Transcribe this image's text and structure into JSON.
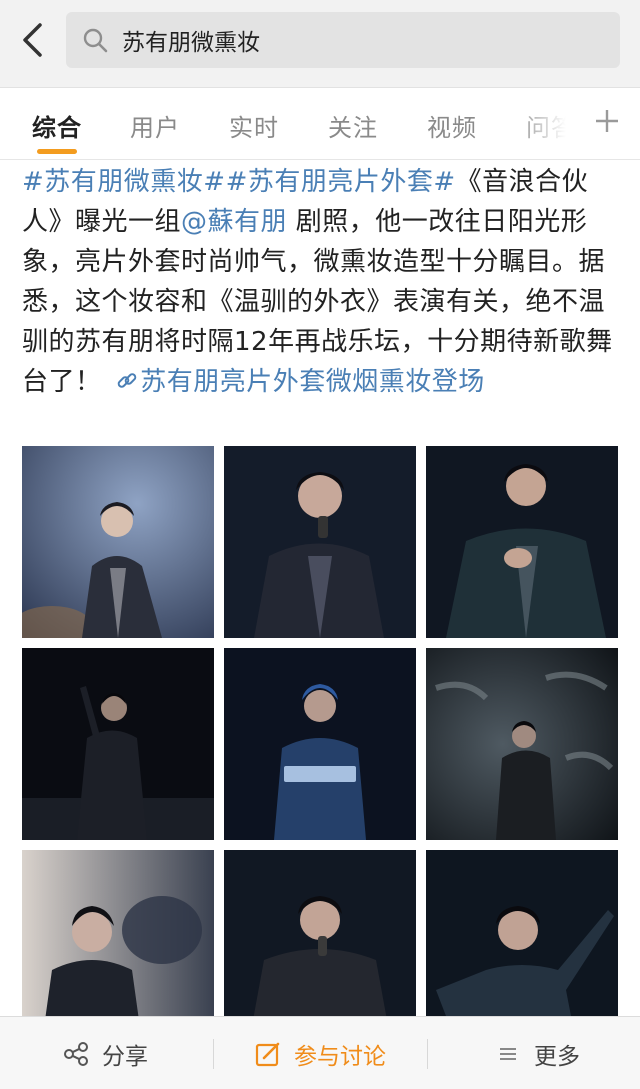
{
  "header": {
    "back_icon": "chevron-left-icon",
    "search_icon": "search-icon",
    "search_query": "苏有朋微熏妆"
  },
  "tabs": [
    {
      "label": "综合",
      "active": true
    },
    {
      "label": "用户",
      "active": false
    },
    {
      "label": "实时",
      "active": false
    },
    {
      "label": "关注",
      "active": false
    },
    {
      "label": "视频",
      "active": false
    },
    {
      "label": "问答",
      "active": false
    }
  ],
  "tab_add_icon": "plus-icon",
  "accent_color": "#f39c1f",
  "link_color": "#4a7fb5",
  "post": {
    "hashtag1": "#苏有朋微熏妆#",
    "hashtag2": "#苏有朋亮片外套#",
    "text1": "《音浪合伙人》曝光一组",
    "mention": "@蘇有朋",
    "text2": " 剧照，他一改往日阳光形象，亮片外套时尚帅气，微熏妆造型十分瞩目。据悉，这个妆容和《温驯的外衣》表演有关，绝不温驯的苏有朋将时隔12年再战乐坛，十分期待新歌舞台了！",
    "link_icon": "link-icon",
    "link_text": "苏有朋亮片外套微烟熏妆登场"
  },
  "photos": [
    {
      "name": "stage-photo"
    },
    {
      "name": "stage-photo"
    },
    {
      "name": "stage-photo"
    },
    {
      "name": "stage-photo"
    },
    {
      "name": "stage-photo"
    },
    {
      "name": "stage-photo"
    },
    {
      "name": "stage-photo"
    },
    {
      "name": "stage-photo"
    },
    {
      "name": "stage-photo"
    }
  ],
  "bottom_bar": {
    "share": {
      "label": "分享",
      "icon": "share-icon"
    },
    "discuss": {
      "label": "参与讨论",
      "icon": "edit-icon"
    },
    "more": {
      "label": "更多",
      "icon": "menu-icon"
    }
  }
}
